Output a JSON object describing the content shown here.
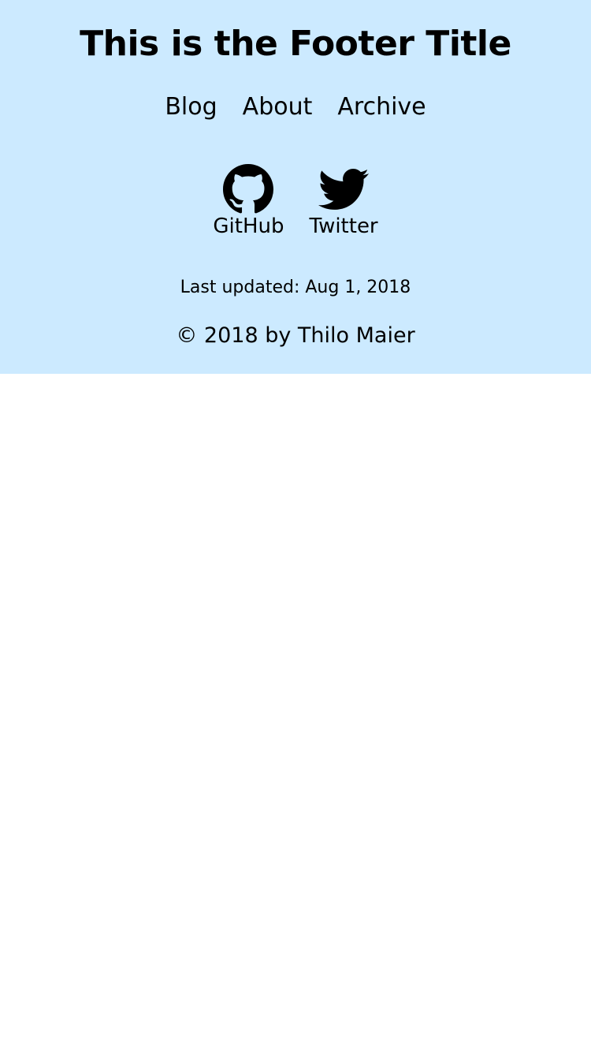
{
  "footer": {
    "title": "This is the Footer Title",
    "nav": [
      {
        "label": "Blog"
      },
      {
        "label": "About"
      },
      {
        "label": "Archive"
      }
    ],
    "social": [
      {
        "label": "GitHub",
        "icon": "github-icon"
      },
      {
        "label": "Twitter",
        "icon": "twitter-icon"
      }
    ],
    "last_updated": "Last updated: Aug 1, 2018",
    "copyright": "© 2018 by Thilo Maier"
  },
  "colors": {
    "footer_background": "#cceaff",
    "page_background": "#ffffff",
    "text": "#000000"
  }
}
